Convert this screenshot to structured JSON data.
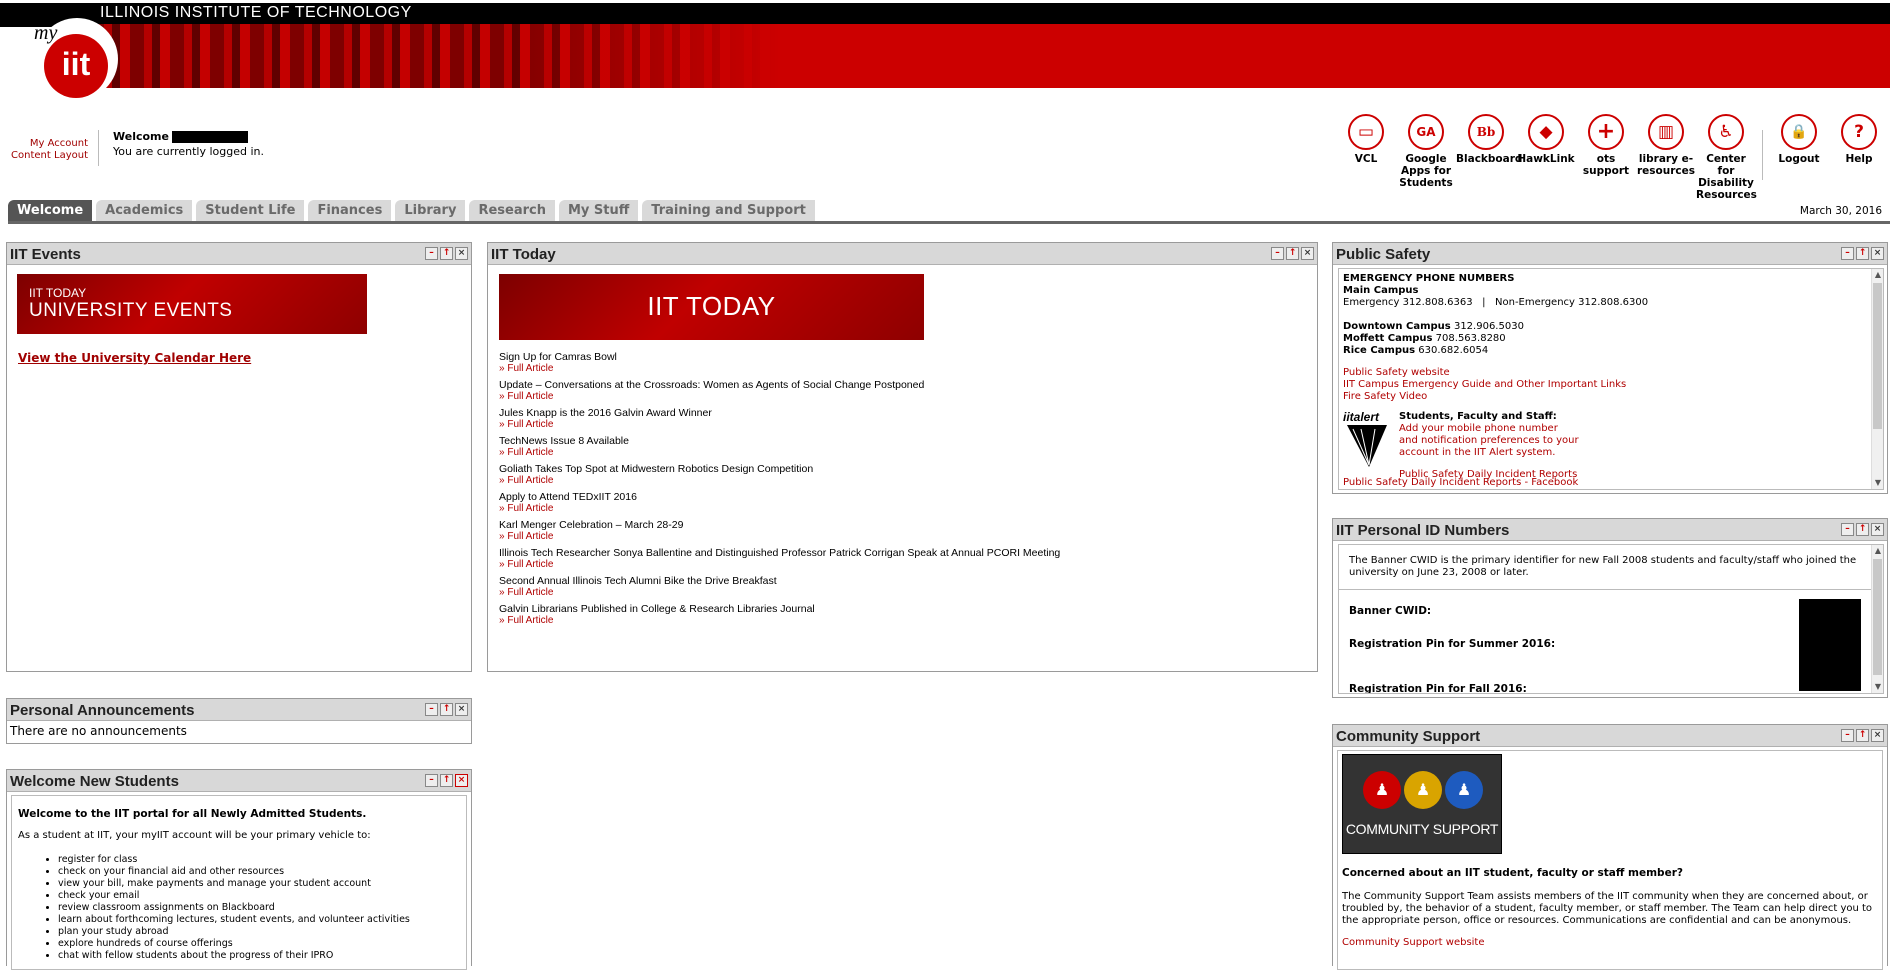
{
  "header": {
    "title": "ILLINOIS INSTITUTE OF TECHNOLOGY",
    "logo_my": "my",
    "logo_iit": "iit"
  },
  "account": {
    "my_account": "My Account",
    "content_layout": "Content Layout",
    "welcome": "Welcome",
    "logged_in": "You are currently logged in."
  },
  "quick_links": [
    {
      "label": "VCL",
      "icon": "monitor-icon",
      "glyph": "▭"
    },
    {
      "label": "Google Apps for Students",
      "icon": "google-apps-icon",
      "glyph": "GA"
    },
    {
      "label": "Blackboard",
      "icon": "blackboard-icon",
      "glyph": "Bb"
    },
    {
      "label": "HawkLink",
      "icon": "hawk-icon",
      "glyph": "◆"
    },
    {
      "label": "ots support",
      "icon": "plus-icon",
      "glyph": "+"
    },
    {
      "label": "library e-resources",
      "icon": "books-icon",
      "glyph": "▥"
    },
    {
      "label": "Center for Disability Resources",
      "icon": "wheelchair-icon",
      "glyph": "♿"
    },
    {
      "label": "Logout",
      "icon": "lock-icon",
      "glyph": "🔒"
    },
    {
      "label": "Help",
      "icon": "help-icon",
      "glyph": "?"
    }
  ],
  "tabs": [
    "Welcome",
    "Academics",
    "Student Life",
    "Finances",
    "Library",
    "Research",
    "My Stuff",
    "Training and Support"
  ],
  "date": "March 30, 2016",
  "events": {
    "title": "IIT Events",
    "banner_l1": "IIT TODAY",
    "banner_l2": "UNIVERSITY EVENTS",
    "link": "View the University Calendar Here"
  },
  "today": {
    "title": "IIT Today",
    "banner": "IIT TODAY",
    "full_article": "» Full Article",
    "items": [
      "Sign Up for Camras Bowl",
      "Update – Conversations at the Crossroads: Women as Agents of Social Change Postponed",
      "Jules Knapp is the 2016 Galvin Award Winner",
      "TechNews Issue 8 Available",
      "Goliath Takes Top Spot at Midwestern Robotics Design Competition",
      "Apply to Attend TEDxIIT 2016",
      "Karl Menger Celebration – March 28-29",
      "Illinois Tech Researcher Sonya Ballentine and Distinguished Professor Patrick Corrigan Speak at Annual PCORI Meeting",
      "Second Annual Illinois Tech Alumni Bike the Drive Breakfast",
      "Galvin Librarians Published in College & Research Libraries Journal"
    ]
  },
  "announcements": {
    "title": "Personal Announcements",
    "text": "There are no announcements"
  },
  "new_students": {
    "title": "Welcome New Students",
    "heading": "Welcome to the IIT portal for all Newly Admitted Students.",
    "intro": "As a student at IIT, your myIIT account will be your primary vehicle to:",
    "items": [
      "register for class",
      "check on your financial aid and other resources",
      "view your bill, make payments and manage your student account",
      "check your email",
      "review classroom assignments on Blackboard",
      "learn about forthcoming lectures, student events, and volunteer activities",
      "plan your study abroad",
      "explore hundreds of course offerings",
      "chat with fellow students about the progress of their IPRO"
    ]
  },
  "public_safety": {
    "title": "Public Safety",
    "emergency_heading": "EMERGENCY PHONE NUMBERS",
    "main_campus": "Main Campus",
    "emergency_line": "Emergency 312.808.6363   |   Non-Emergency 312.808.6300",
    "downtown_label": "Downtown Campus",
    "downtown_num": "312.906.5030",
    "moffett_label": "Moffett Campus",
    "moffett_num": "708.563.8280",
    "rice_label": "Rice Campus",
    "rice_num": "630.682.6054",
    "link1": "Public Safety website",
    "link2": "IIT Campus Emergency Guide and Other Important Links",
    "link3": "Fire Safety Video",
    "alert_logo": "iitalert",
    "alert_heading": "Students, Faculty and Staff:",
    "alert_l1": "Add your mobile phone number",
    "alert_l2": "and notification preferences to your",
    "alert_l3": "account in the IIT Alert system.",
    "reports": "Public Safety Daily Incident Reports",
    "cutoff": "Public Safety Daily Incident Reports - Facebook"
  },
  "id_numbers": {
    "title": "IIT Personal ID Numbers",
    "desc": "The Banner CWID is the primary identifier for new Fall 2008 students and faculty/staff who joined the university on June 23, 2008 or later.",
    "cwid": "Banner CWID:",
    "pin_summer": "Registration Pin for Summer 2016:",
    "pin_fall": "Registration Pin for Fall 2016:"
  },
  "community": {
    "title": "Community Support",
    "logo_text": "COMMUNITY SUPPORT",
    "heading": "Concerned about an IIT student, faculty or staff member?",
    "body": "The Community Support Team assists members of the IIT community when they are concerned about, or troubled by, the behavior of a student, faculty member, or staff member. The Team can help direct you to the appropriate person, office or resources. Communications are confidential and can be anonymous.",
    "link": "Community Support website"
  },
  "colors": {
    "brand_red": "#cc0000",
    "link_red": "#a00000",
    "tab_active": "#555555"
  }
}
